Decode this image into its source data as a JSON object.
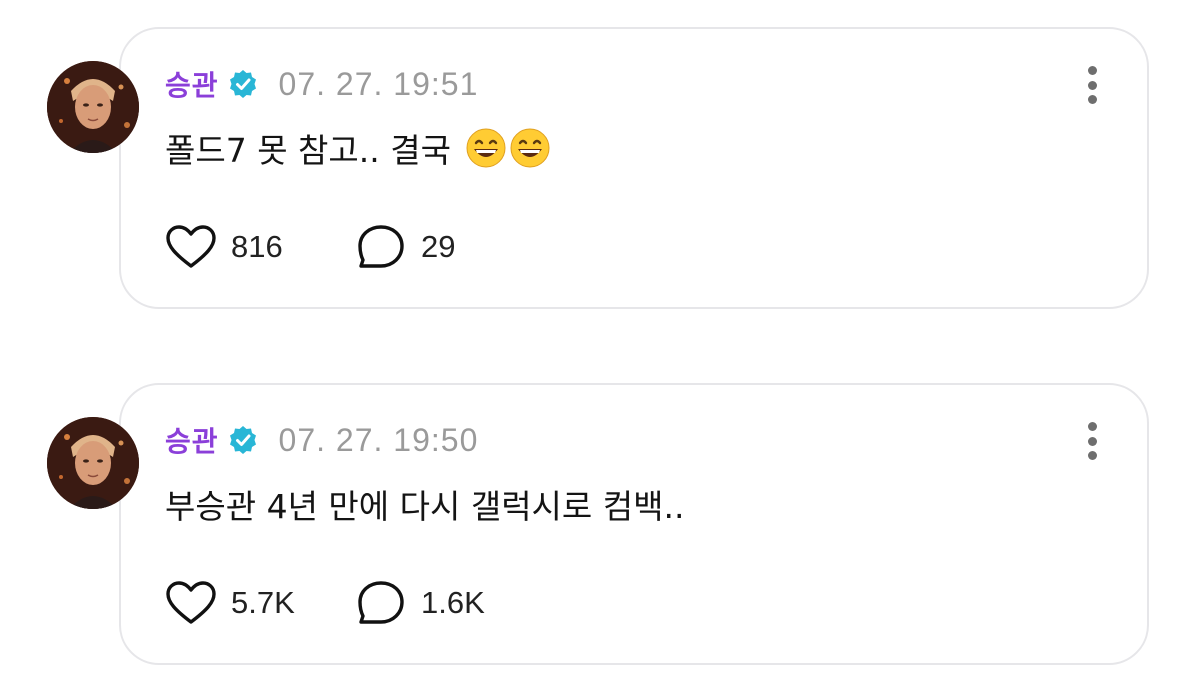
{
  "posts": [
    {
      "author": "승관",
      "timestamp": "07. 27. 19:51",
      "text": "폴드7 못 참고.. 결국",
      "emojis": [
        "😄",
        "😄"
      ],
      "likes": "816",
      "comments": "29",
      "verified_icon": "verified-badge-icon",
      "accent_color": "#8b3fd9",
      "verified_color": "#29b6d6"
    },
    {
      "author": "승관",
      "timestamp": "07. 27. 19:50",
      "text": "부승관 4년 만에 다시 갤럭시로 컴백..",
      "emojis": [],
      "likes": "5.7K",
      "comments": "1.6K",
      "verified_icon": "verified-badge-icon",
      "accent_color": "#8b3fd9",
      "verified_color": "#29b6d6"
    }
  ]
}
